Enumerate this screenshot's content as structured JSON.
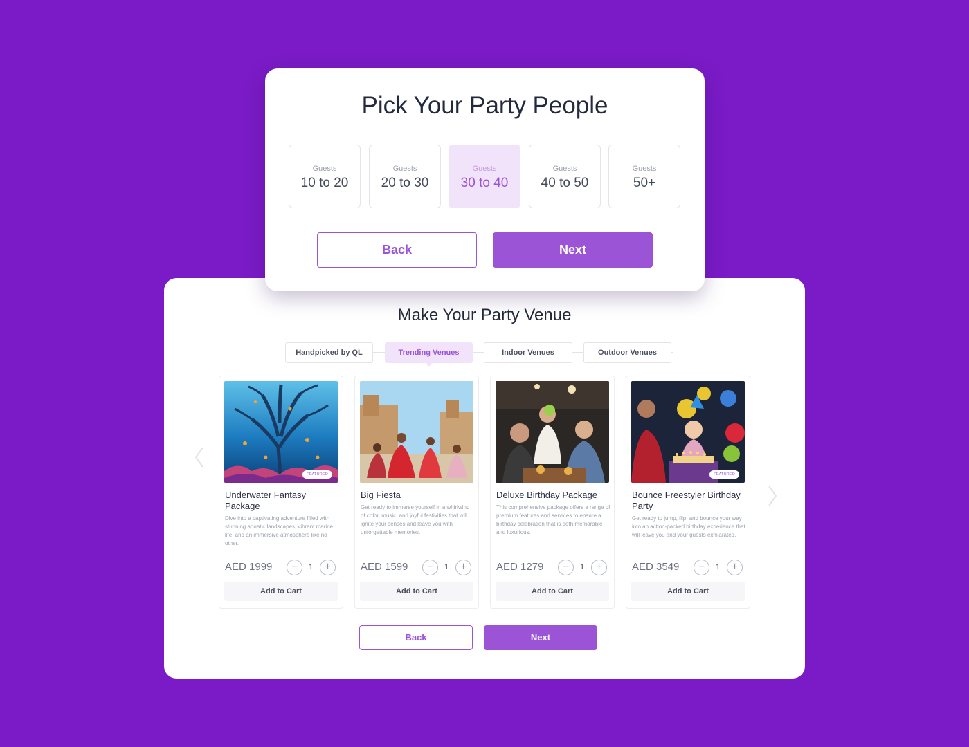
{
  "party_people": {
    "title": "Pick Your Party People",
    "options": [
      {
        "label": "Guests",
        "range": "10 to 20"
      },
      {
        "label": "Guests",
        "range": "20 to 30"
      },
      {
        "label": "Guests",
        "range": "30 to 40",
        "selected": true
      },
      {
        "label": "Guests",
        "range": "40 to 50"
      },
      {
        "label": "Guests",
        "range": "50+"
      }
    ],
    "back_label": "Back",
    "next_label": "Next"
  },
  "venue": {
    "title": "Make Your Party Venue",
    "tabs": [
      {
        "label": "Handpicked by QL"
      },
      {
        "label": "Trending Venues",
        "active": true
      },
      {
        "label": "Indoor Venues"
      },
      {
        "label": "Outdoor Venues"
      }
    ],
    "cards": [
      {
        "name": "Underwater Fantasy Package",
        "badge": "FEATURED",
        "description": "Dive into a captivating adventure filled with stunning aquatic landscapes, vibrant marine life, and an immersive atmosphere like no other.",
        "price": "AED 1999",
        "quantity": "1",
        "add_label": "Add to Cart"
      },
      {
        "name": "Big Fiesta",
        "badge": "",
        "description": "Get ready to immerse yourself in a whirlwind of color, music, and joyful festivities that will ignite your senses and leave you with unforgettable memories.",
        "price": "AED 1599",
        "quantity": "1",
        "add_label": "Add to Cart"
      },
      {
        "name": "Deluxe Birthday Package",
        "badge": "",
        "description": "This comprehensive package offers a range of premium features and services to ensure a birthday celebration that is both memorable and luxurious.",
        "price": "AED 1279",
        "quantity": "1",
        "add_label": "Add to Cart"
      },
      {
        "name": "Bounce Freestyler Birthday Party",
        "badge": "FEATURED",
        "description": "Get ready to jump, flip, and bounce your way into an action-packed birthday experience that will leave you and your guests exhilarated.",
        "price": "AED 3549",
        "quantity": "1",
        "add_label": "Add to Cart"
      }
    ],
    "back_label": "Back",
    "next_label": "Next"
  },
  "icons": {
    "prev": "chevron-left-icon",
    "next": "chevron-right-icon",
    "minus": "minus-circle-icon",
    "plus": "plus-circle-icon"
  },
  "colors": {
    "background": "#7a1bc7",
    "accent": "#9b54d6",
    "accent_light": "#f1e4fa"
  }
}
